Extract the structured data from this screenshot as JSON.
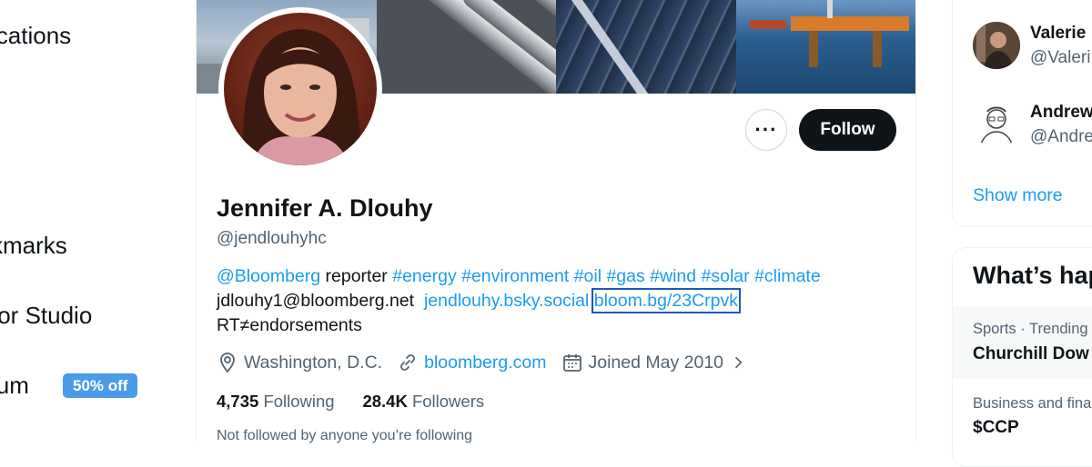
{
  "nav": {
    "items": [
      {
        "label": "ications"
      },
      {
        "label": "kmarks"
      },
      {
        "label": "tor Studio"
      },
      {
        "label": "ium"
      }
    ],
    "premium_badge": "50% off"
  },
  "profile": {
    "name": "Jennifer A. Dlouhy",
    "handle": "@jendlouhyhc",
    "more_label": "···",
    "follow_label": "Follow",
    "bio": {
      "line1_mention": "@Bloomberg",
      "line1_text": " reporter ",
      "hashtags": "#energy #environment #oil #gas #wind #solar #climate",
      "email": "jdlouhy1@bloomberg.net",
      "bsky_link": "jendlouhy.bsky.social",
      "bloom_link": "bloom.bg/23Crpvk",
      "line3": "RT≠endorsements"
    },
    "location": "Washington, D.C.",
    "website": "bloomberg.com",
    "joined": "Joined May 2010",
    "following_count": "4,735",
    "following_label": "Following",
    "followers_count": "28.4K",
    "followers_label": "Followers",
    "not_followed": "Not followed by anyone you’re following"
  },
  "sidebar": {
    "who_to_follow": [
      {
        "name": "Valerie",
        "handle": "@Valeri"
      },
      {
        "name": "Andrew",
        "handle": "@Andre"
      }
    ],
    "show_more": "Show more",
    "whats_happening_title": "What’s hap",
    "trends": [
      {
        "meta": "Sports · Trending",
        "title": "Churchill Dow"
      },
      {
        "meta": "Business and fina",
        "title": "$CCP"
      }
    ]
  },
  "colors": {
    "accent": "#1d9bf0",
    "badge": "#4a9ce8",
    "follow_bg": "#0f1419",
    "muted": "#536471"
  }
}
